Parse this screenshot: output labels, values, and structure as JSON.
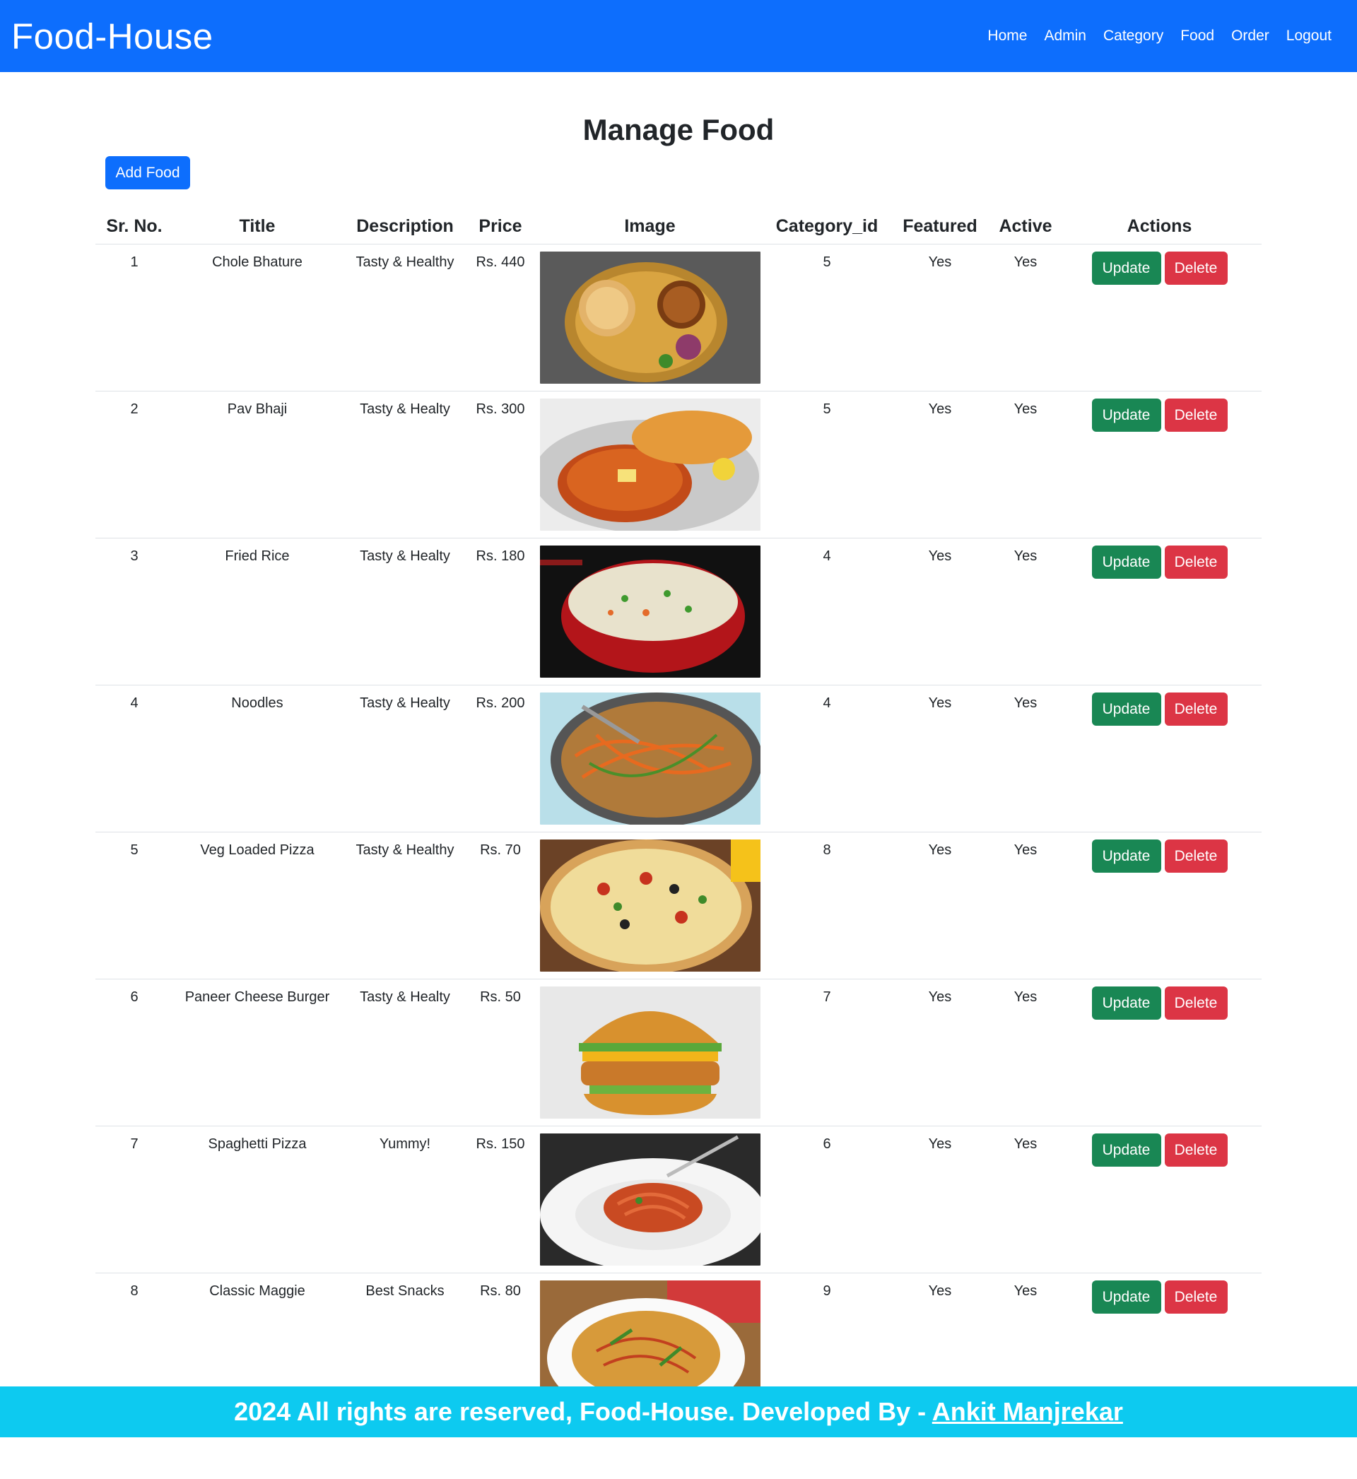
{
  "navbar": {
    "brand": "Food-House",
    "links": [
      "Home",
      "Admin",
      "Category",
      "Food",
      "Order",
      "Logout"
    ]
  },
  "page": {
    "title": "Manage Food",
    "add_button": "Add Food"
  },
  "table": {
    "headers": [
      "Sr. No.",
      "Title",
      "Description",
      "Price",
      "Image",
      "Category_id",
      "Featured",
      "Active",
      "Actions"
    ],
    "update_label": "Update",
    "delete_label": "Delete",
    "rows": [
      {
        "sr": "1",
        "title": "Chole Bhature",
        "description": "Tasty & Healthy",
        "price": "Rs. 440",
        "image": "chole-bhature",
        "category_id": "5",
        "featured": "Yes",
        "active": "Yes"
      },
      {
        "sr": "2",
        "title": "Pav Bhaji",
        "description": "Tasty & Healty",
        "price": "Rs. 300",
        "image": "pav-bhaji",
        "category_id": "5",
        "featured": "Yes",
        "active": "Yes"
      },
      {
        "sr": "3",
        "title": "Fried Rice",
        "description": "Tasty & Healty",
        "price": "Rs. 180",
        "image": "fried-rice",
        "category_id": "4",
        "featured": "Yes",
        "active": "Yes"
      },
      {
        "sr": "4",
        "title": "Noodles",
        "description": "Tasty & Healty",
        "price": "Rs. 200",
        "image": "noodles",
        "category_id": "4",
        "featured": "Yes",
        "active": "Yes"
      },
      {
        "sr": "5",
        "title": "Veg Loaded Pizza",
        "description": "Tasty & Healthy",
        "price": "Rs. 70",
        "image": "pizza",
        "category_id": "8",
        "featured": "Yes",
        "active": "Yes"
      },
      {
        "sr": "6",
        "title": "Paneer Cheese Burger",
        "description": "Tasty & Healty",
        "price": "Rs. 50",
        "image": "burger",
        "category_id": "7",
        "featured": "Yes",
        "active": "Yes"
      },
      {
        "sr": "7",
        "title": "Spaghetti Pizza",
        "description": "Yummy!",
        "price": "Rs. 150",
        "image": "spaghetti",
        "category_id": "6",
        "featured": "Yes",
        "active": "Yes"
      },
      {
        "sr": "8",
        "title": "Classic Maggie",
        "description": "Best Snacks",
        "price": "Rs. 80",
        "image": "maggie",
        "category_id": "9",
        "featured": "Yes",
        "active": "Yes"
      }
    ]
  },
  "footer": {
    "text": "2024 All rights are reserved, Food-House. Developed By - ",
    "author": "Ankit Manjrekar"
  },
  "colors": {
    "primary": "#0d6efd",
    "success": "#198754",
    "danger": "#dc3545",
    "info": "#0dcaf0"
  }
}
